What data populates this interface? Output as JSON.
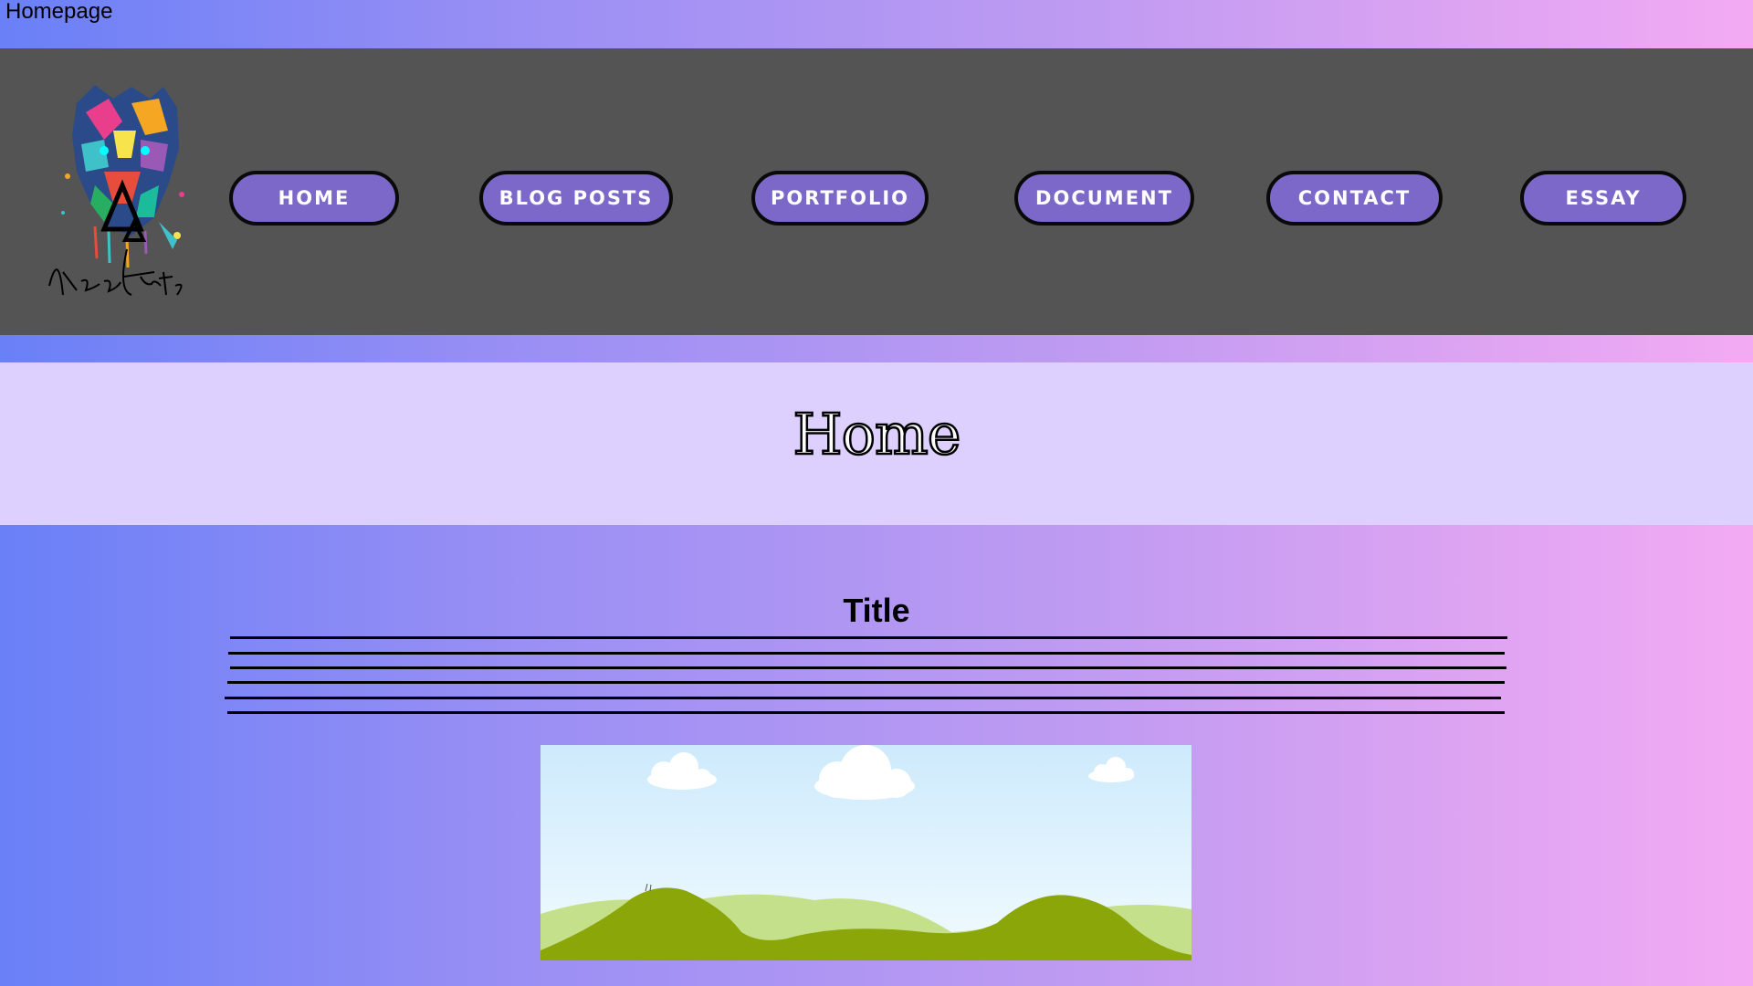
{
  "page": {
    "label": "Homepage"
  },
  "header": {
    "logo_text": "Kcee Arts",
    "nav": [
      {
        "label": "Home"
      },
      {
        "label": "Blog Posts"
      },
      {
        "label": "Portfolio"
      },
      {
        "label": "Document"
      },
      {
        "label": "Contact"
      },
      {
        "label": "Essay"
      }
    ]
  },
  "banner": {
    "title": "Home"
  },
  "content": {
    "title": "Title"
  },
  "colors": {
    "nav_button": "#7b68c8",
    "header_bg": "#545454",
    "banner_bg": "#ddd0ff"
  }
}
